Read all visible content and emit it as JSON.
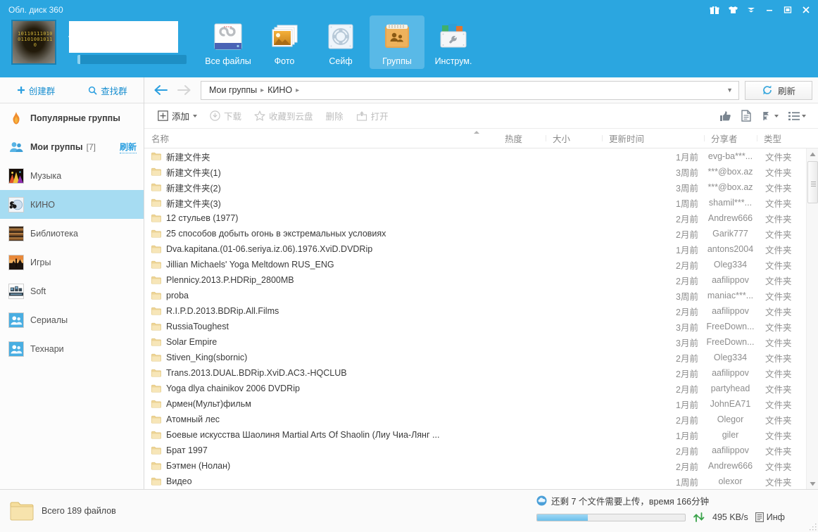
{
  "window": {
    "title": "Обл. диск 360",
    "buttons": [
      {
        "name": "gift-icon",
        "glyph": "gift"
      },
      {
        "name": "shirt-icon",
        "glyph": "shirt"
      },
      {
        "name": "chevron-down-icon",
        "glyph": "chevron"
      },
      {
        "name": "minimize-button",
        "glyph": "minimize"
      },
      {
        "name": "maximize-button",
        "glyph": "maximize"
      },
      {
        "name": "close-button",
        "glyph": "close"
      }
    ]
  },
  "top_nav": {
    "items": [
      {
        "label": "Все файлы",
        "icon": "all-files-icon",
        "active": false
      },
      {
        "label": "Фото",
        "icon": "photo-icon",
        "active": false
      },
      {
        "label": "Сейф",
        "icon": "safe-icon",
        "active": false
      },
      {
        "label": "Группы",
        "icon": "groups-icon",
        "active": true
      },
      {
        "label": "Инструм.",
        "icon": "tools-icon",
        "active": false
      }
    ]
  },
  "sidebar": {
    "actions": [
      {
        "label": "创建群",
        "icon": "plus-icon"
      },
      {
        "label": "查找群",
        "icon": "search-icon"
      }
    ],
    "popular": {
      "label": "Популярные группы",
      "icon": "flame-icon"
    },
    "my_groups": {
      "label": "Мои группы",
      "count": "[7]",
      "refresh": "刷新",
      "icon": "people-icon"
    },
    "groups": [
      {
        "label": "Музыка",
        "icon": "thumb-music"
      },
      {
        "label": "КИНО",
        "icon": "thumb-kino",
        "selected": true
      },
      {
        "label": "Библиотека",
        "icon": "thumb-library"
      },
      {
        "label": "Игры",
        "icon": "thumb-games"
      },
      {
        "label": "Soft",
        "icon": "thumb-soft"
      },
      {
        "label": "Сериалы",
        "icon": "thumb-people"
      },
      {
        "label": "Технари",
        "icon": "thumb-people"
      }
    ]
  },
  "path_bar": {
    "back": "back-arrow",
    "forward": "forward-arrow",
    "crumbs": [
      "Мои группы",
      "КИНО"
    ],
    "refresh_label": "刷新"
  },
  "toolbar": {
    "add_label": "添加",
    "download_label": "下载",
    "favorite_label": "收藏到云盘",
    "delete_label": "删除",
    "open_label": "打开",
    "right_icons": [
      "thumbs-up-icon",
      "document-icon",
      "sort-icon",
      "list-view-icon"
    ]
  },
  "columns": {
    "name": "名称",
    "hot": "热度",
    "size": "大小",
    "time": "更新时间",
    "sharer": "分享者",
    "type": "类型"
  },
  "files": [
    {
      "name": "新建文件夹",
      "hot": "",
      "size": "",
      "time": "1月前",
      "sharer": "evg-ba***...",
      "type": "文件夹"
    },
    {
      "name": "新建文件夹(1)",
      "hot": "",
      "size": "",
      "time": "3周前",
      "sharer": "***@box.az",
      "type": "文件夹"
    },
    {
      "name": "新建文件夹(2)",
      "hot": "",
      "size": "",
      "time": "3周前",
      "sharer": "***@box.az",
      "type": "文件夹"
    },
    {
      "name": "新建文件夹(3)",
      "hot": "",
      "size": "",
      "time": "1周前",
      "sharer": "shamil***...",
      "type": "文件夹"
    },
    {
      "name": "12 стульев (1977)",
      "hot": "",
      "size": "",
      "time": "2月前",
      "sharer": "Andrew666",
      "type": "文件夹"
    },
    {
      "name": "25 способов добыть огонь в экстремальных условиях",
      "hot": "",
      "size": "",
      "time": "2月前",
      "sharer": "Garik777",
      "type": "文件夹"
    },
    {
      "name": "Dva.kapitana.(01-06.seriya.iz.06).1976.XviD.DVDRip",
      "hot": "",
      "size": "",
      "time": "1月前",
      "sharer": "antons2004",
      "type": "文件夹"
    },
    {
      "name": "Jillian Michaels' Yoga Meltdown RUS_ENG",
      "hot": "",
      "size": "",
      "time": "2月前",
      "sharer": "Oleg334",
      "type": "文件夹"
    },
    {
      "name": "Plennicy.2013.P.HDRip_2800MB",
      "hot": "",
      "size": "",
      "time": "2月前",
      "sharer": "aafilippov",
      "type": "文件夹"
    },
    {
      "name": "proba",
      "hot": "",
      "size": "",
      "time": "3周前",
      "sharer": "maniac***...",
      "type": "文件夹"
    },
    {
      "name": "R.I.P.D.2013.BDRip.All.Films",
      "hot": "",
      "size": "",
      "time": "2月前",
      "sharer": "aafilippov",
      "type": "文件夹"
    },
    {
      "name": "RussiaToughest",
      "hot": "",
      "size": "",
      "time": "3月前",
      "sharer": "FreeDown...",
      "type": "文件夹"
    },
    {
      "name": "Solar Empire",
      "hot": "",
      "size": "",
      "time": "3月前",
      "sharer": "FreeDown...",
      "type": "文件夹"
    },
    {
      "name": "Stiven_King(sbornic)",
      "hot": "",
      "size": "",
      "time": "2月前",
      "sharer": "Oleg334",
      "type": "文件夹"
    },
    {
      "name": "Trans.2013.DUAL.BDRip.XviD.AC3.-HQCLUB",
      "hot": "",
      "size": "",
      "time": "2月前",
      "sharer": "aafilippov",
      "type": "文件夹"
    },
    {
      "name": "Yoga dlya chainikov 2006 DVDRip",
      "hot": "",
      "size": "",
      "time": "2月前",
      "sharer": "partyhead",
      "type": "文件夹"
    },
    {
      "name": "Армен(Мульт)фильм",
      "hot": "",
      "size": "",
      "time": "1月前",
      "sharer": "JohnEA71",
      "type": "文件夹"
    },
    {
      "name": "Атомный лес",
      "hot": "",
      "size": "",
      "time": "2月前",
      "sharer": "Olegor",
      "type": "文件夹"
    },
    {
      "name": "Боевые искусства Шаолиня  Martial Arts Of Shaolin (Лиу Чиа-Лянг ...",
      "hot": "",
      "size": "",
      "time": "1月前",
      "sharer": "giler",
      "type": "文件夹"
    },
    {
      "name": "Брат 1997",
      "hot": "",
      "size": "",
      "time": "2月前",
      "sharer": "aafilippov",
      "type": "文件夹"
    },
    {
      "name": "Бэтмен (Нолан)",
      "hot": "",
      "size": "",
      "time": "2月前",
      "sharer": "Andrew666",
      "type": "文件夹"
    },
    {
      "name": "Видео",
      "hot": "",
      "size": "",
      "time": "1周前",
      "sharer": "olexor",
      "type": "文件夹"
    }
  ],
  "status": {
    "total": "Всего 189 файлов",
    "upload_text": "还剩 7 个文件需要上传，время 166分钟",
    "speed": "495 KB/s",
    "info_label": "Инф"
  },
  "colors": {
    "header_blue": "#2ba6e0",
    "accent": "#1a8fd0",
    "selection": "#a6dcf2",
    "folder_yellow": "#f2d492"
  }
}
